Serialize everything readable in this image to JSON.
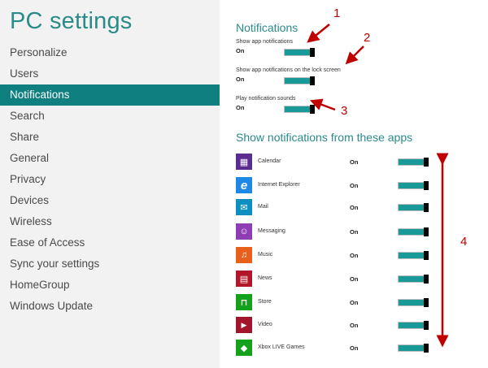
{
  "left_panel": {
    "title": "PC settings",
    "items": [
      {
        "label": "Personalize"
      },
      {
        "label": "Users"
      },
      {
        "label": "Notifications",
        "selected": true
      },
      {
        "label": "Search"
      },
      {
        "label": "Share"
      },
      {
        "label": "General"
      },
      {
        "label": "Privacy"
      },
      {
        "label": "Devices"
      },
      {
        "label": "Wireless"
      },
      {
        "label": "Ease of Access"
      },
      {
        "label": "Sync your settings"
      },
      {
        "label": "HomeGroup"
      },
      {
        "label": "Windows Update"
      }
    ]
  },
  "notifications": {
    "title": "Notifications",
    "settings": [
      {
        "label": "Show app notifications",
        "state": "On"
      },
      {
        "label": "Show app notifications on the lock screen",
        "state": "On"
      },
      {
        "label": "Play notification sounds",
        "state": "On"
      }
    ]
  },
  "apps_section": {
    "title": "Show notifications from these apps",
    "apps": [
      {
        "name": "Calendar",
        "state": "On",
        "icon": "calendar-icon",
        "color": "#5c2d91"
      },
      {
        "name": "Internet Explorer",
        "state": "On",
        "icon": "internet-explorer-icon",
        "color": "#1e88e5"
      },
      {
        "name": "Mail",
        "state": "On",
        "icon": "mail-icon",
        "color": "#0d8fbf"
      },
      {
        "name": "Messaging",
        "state": "On",
        "icon": "messaging-icon",
        "color": "#8e3db5"
      },
      {
        "name": "Music",
        "state": "On",
        "icon": "music-icon",
        "color": "#e8601c"
      },
      {
        "name": "News",
        "state": "On",
        "icon": "news-icon",
        "color": "#b3162b"
      },
      {
        "name": "Store",
        "state": "On",
        "icon": "store-icon",
        "color": "#16a11c"
      },
      {
        "name": "Video",
        "state": "On",
        "icon": "video-icon",
        "color": "#a3152a"
      },
      {
        "name": "Xbox LIVE Games",
        "state": "On",
        "icon": "xbox-games-icon",
        "color": "#16a11c"
      }
    ]
  },
  "annotations": [
    "1",
    "2",
    "3",
    "4"
  ],
  "colors": {
    "accent": "#2b8a8a",
    "selected_bg": "#0f7f80",
    "toggle_on": "#1a9999",
    "annotation": "#c00000"
  }
}
